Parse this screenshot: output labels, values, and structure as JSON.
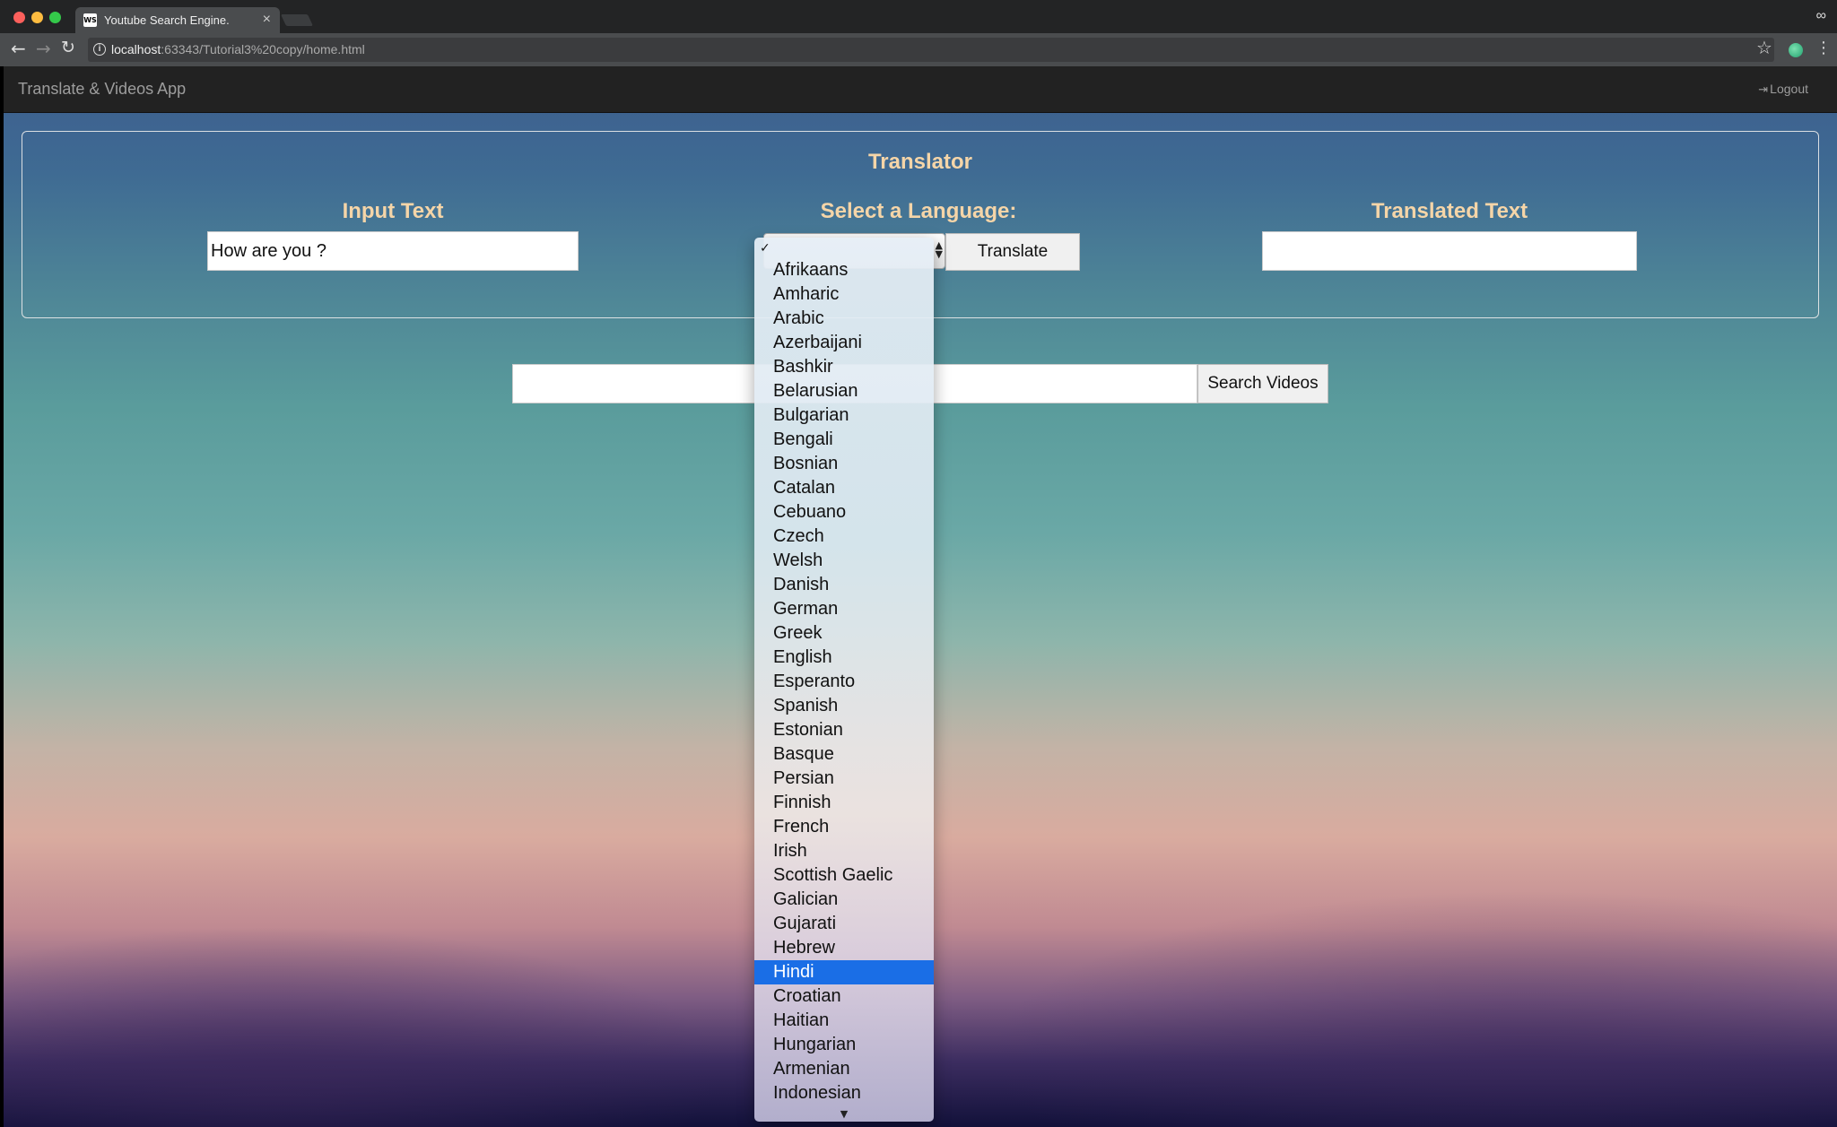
{
  "browser": {
    "tab_title": "Youtube Search Engine.",
    "favicon_text": "WS",
    "url_host": "localhost",
    "url_rest": ":63343/Tutorial3%20copy/home.html"
  },
  "navbar": {
    "brand": "Translate & Videos App",
    "logout": "Logout"
  },
  "translator": {
    "title": "Translator",
    "input_label": "Input Text",
    "input_value": "How are you ?",
    "language_label": "Select a Language:",
    "translate_button": "Translate",
    "output_label": "Translated Text",
    "output_value": ""
  },
  "search": {
    "input_value": "",
    "button": "Search Videos"
  },
  "dropdown": {
    "check": "✓",
    "selected": "Hindi",
    "options": [
      "Afrikaans",
      "Amharic",
      "Arabic",
      "Azerbaijani",
      "Bashkir",
      "Belarusian",
      "Bulgarian",
      "Bengali",
      "Bosnian",
      "Catalan",
      "Cebuano",
      "Czech",
      "Welsh",
      "Danish",
      "German",
      "Greek",
      "English",
      "Esperanto",
      "Spanish",
      "Estonian",
      "Basque",
      "Persian",
      "Finnish",
      "French",
      "Irish",
      "Scottish Gaelic",
      "Galician",
      "Gujarati",
      "Hebrew",
      "Hindi",
      "Croatian",
      "Haitian",
      "Hungarian",
      "Armenian",
      "Indonesian"
    ]
  },
  "colors": {
    "label": "#f5d5a8",
    "navbar": "#222222",
    "selection": "#1a6ee6"
  }
}
